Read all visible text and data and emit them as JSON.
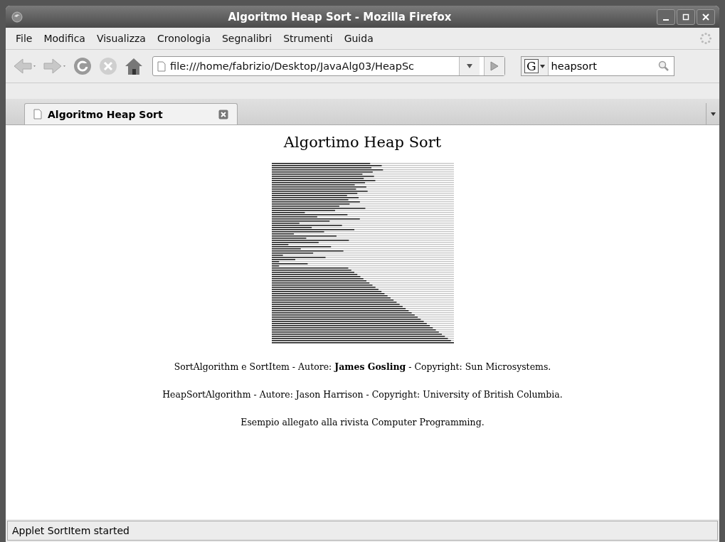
{
  "window": {
    "title": "Algoritmo Heap Sort - Mozilla Firefox"
  },
  "menu": [
    "File",
    "Modifica",
    "Visualizza",
    "Cronologia",
    "Segnalibri",
    "Strumenti",
    "Guida"
  ],
  "address_bar": {
    "value": "file:///home/fabrizio/Desktop/JavaAlg03/HeapSc"
  },
  "search": {
    "engine": "G",
    "value": "heapsort"
  },
  "tabs": [
    {
      "label": "Algoritmo Heap Sort",
      "selected": true
    }
  ],
  "page": {
    "heading": "Algortimo Heap Sort",
    "paragraphs": [
      "SortAlgorithm e SortItem - Autore: **James Gosling** - Copyright: Sun Microsystems.",
      "HeapSortAlgorithm - Autore: Jason Harrison - Copyright: University of British Columbia.",
      "Esempio allegato alla rivista Computer Programming."
    ]
  },
  "status_bar": "Applet SortItem started"
}
